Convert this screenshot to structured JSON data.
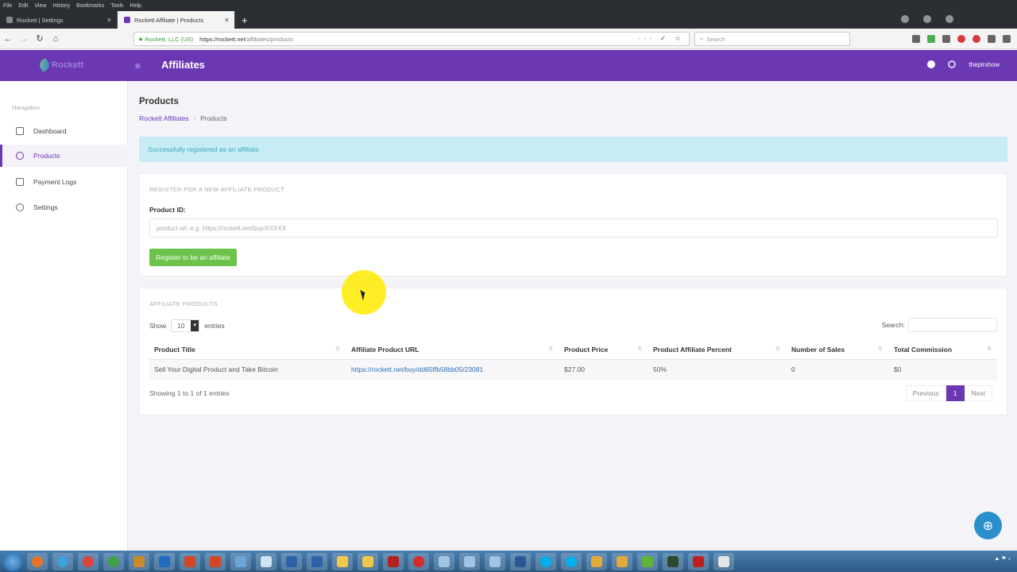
{
  "browser": {
    "menu": [
      "File",
      "Edit",
      "View",
      "History",
      "Bookmarks",
      "Tools",
      "Help"
    ],
    "tabs": [
      {
        "label": "Rockett | Settings",
        "active": false
      },
      {
        "label": "Rockett Affiliate | Products",
        "active": true
      }
    ],
    "new_tab": "+",
    "url_org": "Rockett, LLC (US)",
    "url_host": "https://rockett.net",
    "url_path": "/affiliates/products",
    "search_placeholder": "Search"
  },
  "header": {
    "logo_text": "Rockett",
    "title": "Affiliates",
    "username": "theplrshow"
  },
  "sidebar": {
    "heading": "Navigation",
    "items": [
      {
        "label": "Dashboard",
        "icon": "home-icon"
      },
      {
        "label": "Products",
        "icon": "globe-icon"
      },
      {
        "label": "Payment Logs",
        "icon": "wallet-icon"
      },
      {
        "label": "Settings",
        "icon": "gear-icon"
      }
    ]
  },
  "page": {
    "title": "Products",
    "breadcrumb": {
      "parent": "Rockett Affiliates",
      "separator": "/",
      "current": "Products"
    },
    "alert": "Successfully registered as an affiliate"
  },
  "register": {
    "heading": "REGISTER FOR A NEW AFFILIATE PRODUCT",
    "label": "Product ID:",
    "placeholder": "product url. e.g. https://rockett.net/buy/XXXXX",
    "button": "Register to be an affiliate"
  },
  "affiliate": {
    "heading": "AFFILIATE PRODUCTS",
    "show_label": "Show",
    "entries_value": "10",
    "entries_label": "entries",
    "search_label": "Search:",
    "columns": [
      "Product Title",
      "Affiliate Product URL",
      "Product Price",
      "Product Affiliate Percent",
      "Number of Sales",
      "Total Commission"
    ],
    "rows": [
      [
        "Sell Your Digital Product and Take Bitcoin",
        "https://rockett.net/buy/dd65ffb58bb05/23081",
        "$27.00",
        "50%",
        "0",
        "$0"
      ]
    ],
    "showing": "Showing 1 to 1 of 1 entries",
    "pager": {
      "previous": "Previous",
      "page": "1",
      "next": "Next"
    }
  },
  "colors": {
    "brand": "#6b37b3",
    "success": "#6cc24a",
    "alert_bg": "#c8ecf3",
    "link": "#2f6fb0"
  }
}
